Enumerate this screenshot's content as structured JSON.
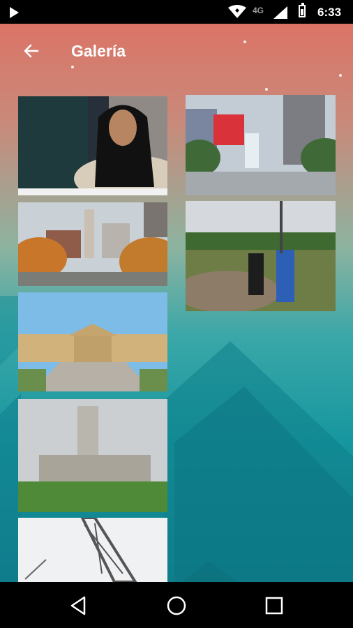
{
  "status_bar": {
    "network": "4G",
    "time": "6:33"
  },
  "toolbar": {
    "title": "Galería",
    "back_icon": "arrow-back-icon"
  },
  "gallery": {
    "items": [
      {
        "name": "photo-woman-portrait"
      },
      {
        "name": "photo-love-sculpture"
      },
      {
        "name": "photo-city-hall-avenue"
      },
      {
        "name": "photo-park-field"
      },
      {
        "name": "photo-art-museum"
      },
      {
        "name": "photo-tower-building"
      },
      {
        "name": "photo-radio-tower"
      }
    ]
  },
  "colors": {
    "gradient_top": "#db7467",
    "gradient_bottom": "#0f7c8c"
  },
  "nav_bar": {
    "icons": [
      "back-triangle-icon",
      "home-circle-icon",
      "recents-square-icon"
    ]
  }
}
